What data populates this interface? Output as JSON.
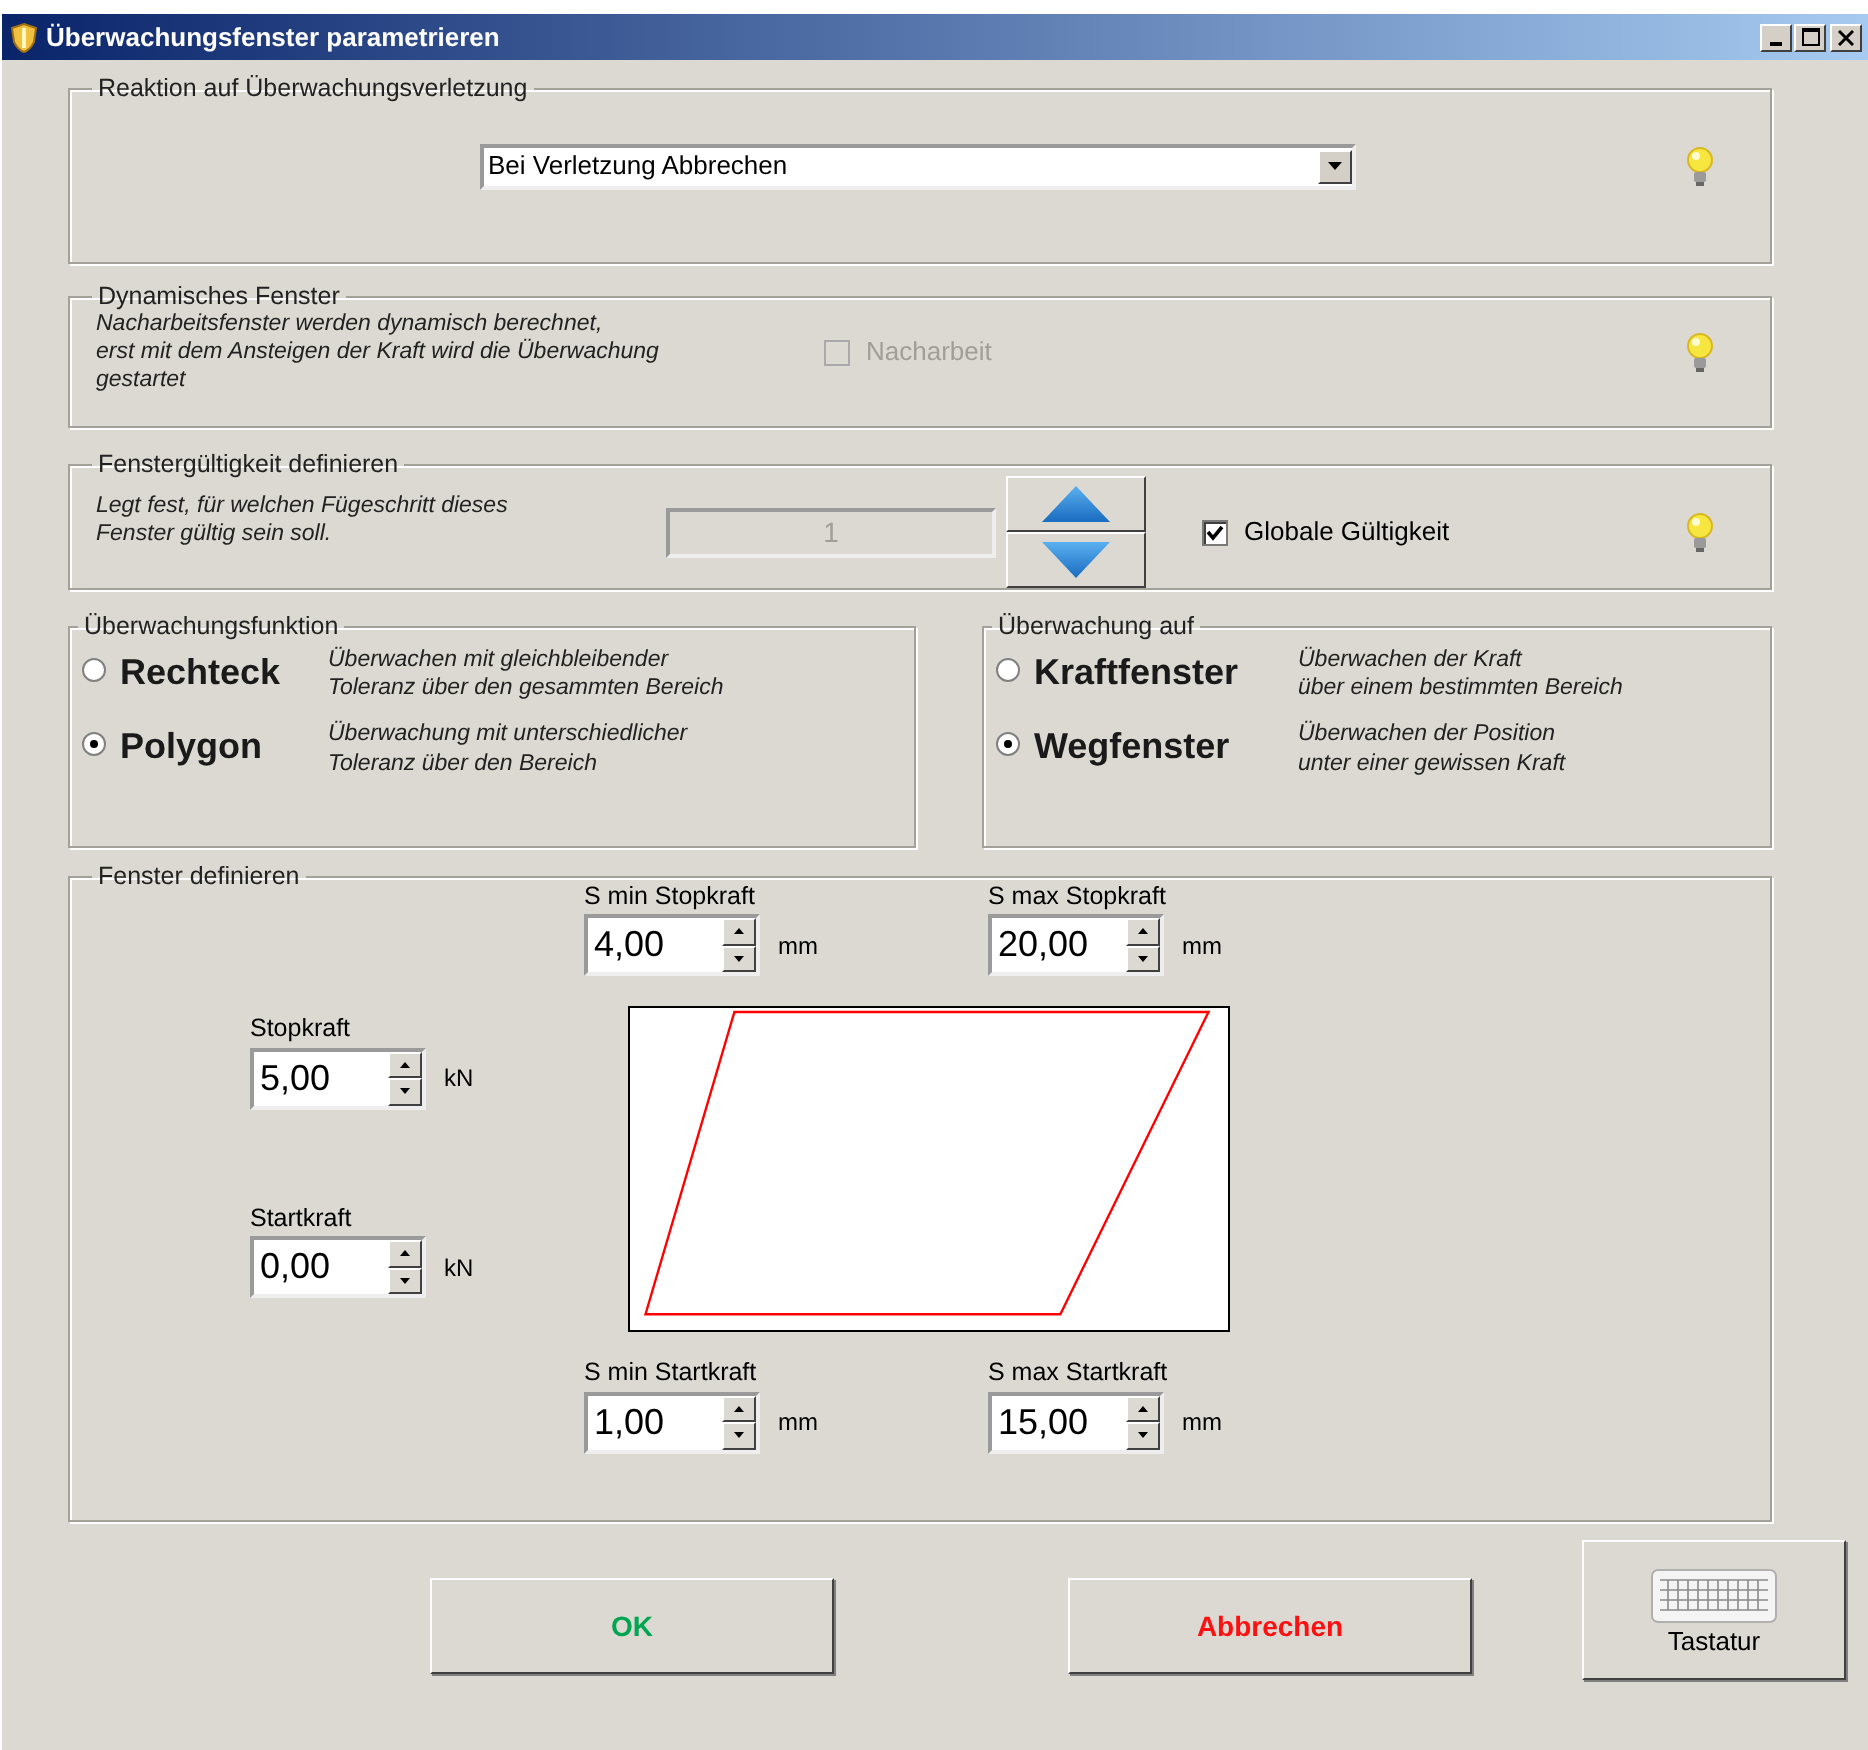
{
  "window": {
    "title": "Überwachungsfenster parametrieren"
  },
  "reaction": {
    "legend": "Reaktion auf Überwachungsverletzung",
    "select": {
      "value": "Bei Verletzung Abbrechen"
    }
  },
  "dynamic": {
    "legend": "Dynamisches Fenster",
    "description": "Nacharbeitsfenster werden dynamisch berechnet,\nerst mit dem Ansteigen der Kraft wird die Überwachung\ngestartet",
    "checkbox": {
      "label": "Nacharbeit",
      "checked": false,
      "disabled": true
    }
  },
  "validity": {
    "legend": "Fenstergültigkeit definieren",
    "description": "Legt fest, für welchen Fügeschritt dieses\nFenster gültig sein soll.",
    "step_field": {
      "value": "1",
      "disabled": true
    },
    "checkbox": {
      "label": "Globale Gültigkeit",
      "checked": true,
      "disabled": false
    }
  },
  "function_group": {
    "legend": "Überwachungsfunktion",
    "options": [
      {
        "label": "Rechteck",
        "description": "Überwachen mit gleichbleibender\nToleranz über den gesammten Bereich",
        "selected": false
      },
      {
        "label": "Polygon",
        "description": "Überwachung mit unterschiedlicher\nToleranz über den Bereich",
        "selected": true
      }
    ]
  },
  "target_group": {
    "legend": "Überwachung auf",
    "options": [
      {
        "label": "Kraftfenster",
        "description": "Überwachen der Kraft\nüber einem bestimmten Bereich",
        "selected": false
      },
      {
        "label": "Wegfenster",
        "description": "Überwachen der Position\nunter einer gewissen Kraft",
        "selected": true
      }
    ]
  },
  "window_definition": {
    "legend": "Fenster definieren",
    "s_min_stop": {
      "label": "S min Stopkraft",
      "value": "4,00",
      "unit": "mm"
    },
    "s_max_stop": {
      "label": "S max Stopkraft",
      "value": "20,00",
      "unit": "mm"
    },
    "stop_force": {
      "label": "Stopkraft",
      "value": "5,00",
      "unit": "kN"
    },
    "start_force": {
      "label": "Startkraft",
      "value": "0,00",
      "unit": "kN"
    },
    "s_min_start": {
      "label": "S min Startkraft",
      "value": "1,00",
      "unit": "mm"
    },
    "s_max_start": {
      "label": "S max Startkraft",
      "value": "15,00",
      "unit": "mm"
    }
  },
  "buttons": {
    "ok": "OK",
    "cancel": "Abbrechen",
    "keyboard": "Tastatur"
  }
}
